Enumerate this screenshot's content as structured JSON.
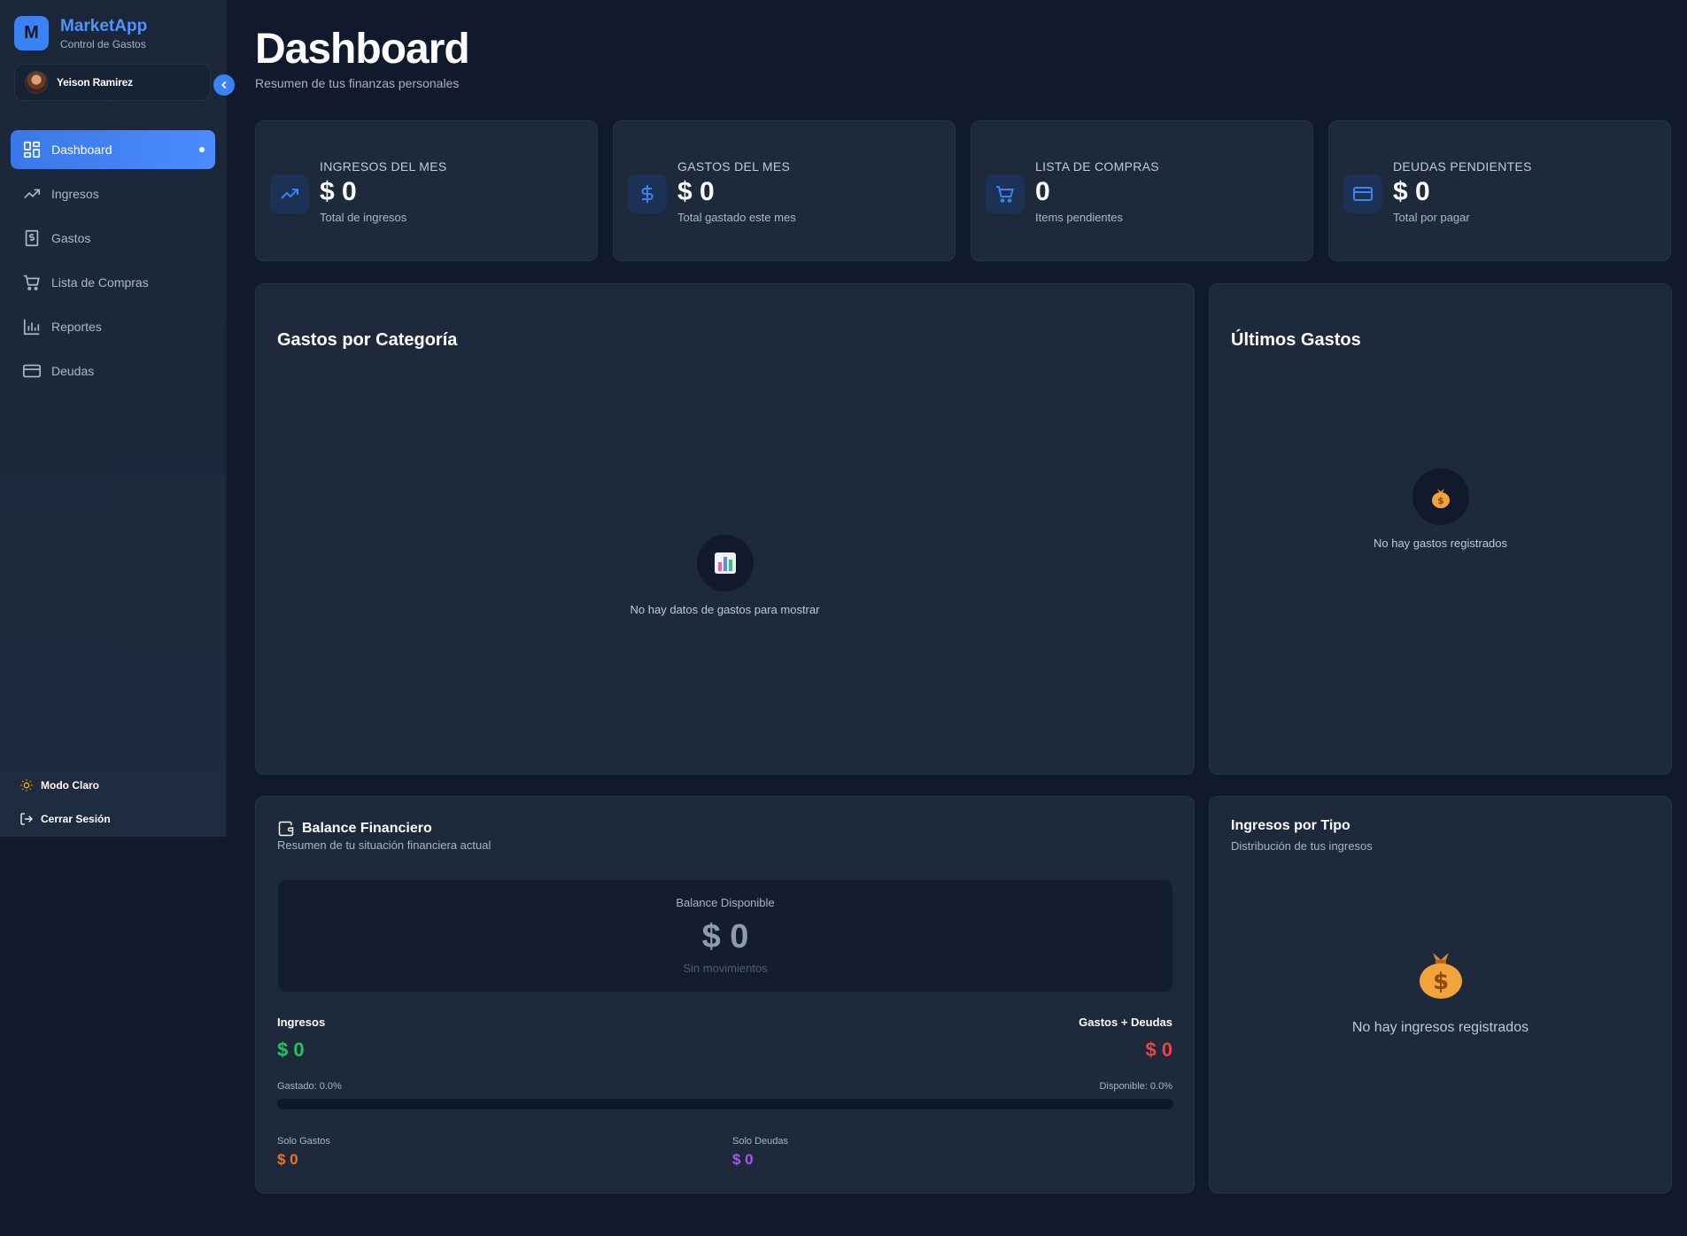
{
  "brand": {
    "logo_letter": "M",
    "name": "MarketApp",
    "subtitle": "Control de Gastos"
  },
  "user": {
    "name": "Yeison Ramirez"
  },
  "sidebar": {
    "items": [
      {
        "label": "Dashboard",
        "icon": "dashboard-icon",
        "active": true
      },
      {
        "label": "Ingresos",
        "icon": "trending-up-icon"
      },
      {
        "label": "Gastos",
        "icon": "dollar-receipt-icon"
      },
      {
        "label": "Lista de Compras",
        "icon": "cart-icon"
      },
      {
        "label": "Reportes",
        "icon": "bar-chart-icon"
      },
      {
        "label": "Deudas",
        "icon": "credit-card-icon"
      }
    ],
    "theme_toggle": "Modo Claro",
    "logout": "Cerrar Sesión"
  },
  "header": {
    "title": "Dashboard",
    "subtitle": "Resumen de tus finanzas personales"
  },
  "stats": [
    {
      "label": "INGRESOS DEL MES",
      "value": "$ 0",
      "desc": "Total de ingresos",
      "icon": "trending-up-icon"
    },
    {
      "label": "GASTOS DEL MES",
      "value": "$ 0",
      "desc": "Total gastado este mes",
      "icon": "dollar-icon"
    },
    {
      "label": "LISTA DE COMPRAS",
      "value": "0",
      "desc": "Items pendientes",
      "icon": "cart-icon"
    },
    {
      "label": "DEUDAS PENDIENTES",
      "value": "$ 0",
      "desc": "Total por pagar",
      "icon": "credit-card-icon"
    }
  ],
  "categories_panel": {
    "title": "Gastos por Categoría",
    "empty": "No hay datos de gastos para mostrar",
    "icon": "bar-chart-emoji"
  },
  "latest_panel": {
    "title": "Últimos Gastos",
    "empty": "No hay gastos registrados",
    "icon": "money-bag-emoji"
  },
  "balance_panel": {
    "title": "Balance Financiero",
    "subtitle": "Resumen de tu situación financiera actual",
    "available_label": "Balance Disponible",
    "available_value": "$ 0",
    "status": "Sin movimientos",
    "income_label": "Ingresos",
    "income_value": "$ 0",
    "outflow_label": "Gastos + Deudas",
    "outflow_value": "$ 0",
    "spent_pct": "Gastado: 0.0%",
    "available_pct": "Disponible: 0.0%",
    "progress": 0,
    "only_expenses_label": "Solo Gastos",
    "only_expenses_value": "$ 0",
    "only_debts_label": "Solo Deudas",
    "only_debts_value": "$ 0"
  },
  "income_type_panel": {
    "title": "Ingresos por Tipo",
    "subtitle": "Distribución de tus ingresos",
    "empty": "No hay ingresos registrados",
    "icon": "money-bag-emoji"
  },
  "colors": {
    "accent": "#3b82f6",
    "income": "#22c55e",
    "outflow": "#ef4444",
    "expenses": "#f97316",
    "debts": "#a855f7"
  }
}
